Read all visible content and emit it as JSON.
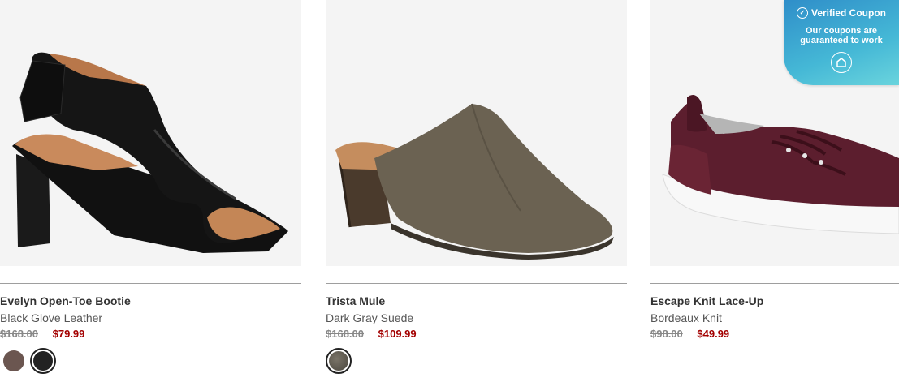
{
  "products": [
    {
      "name": "Evelyn Open-Toe Bootie",
      "color": "Black Glove Leather",
      "old_price": "$168.00",
      "sale_price": "$79.99",
      "swatches": [
        {
          "color": "#6b5650",
          "selected": false
        },
        {
          "color": "#222222",
          "selected": true
        }
      ]
    },
    {
      "name": "Trista Mule",
      "color": "Dark Gray Suede",
      "old_price": "$168.00",
      "sale_price": "$109.99",
      "swatches": [
        {
          "color": "#5e5a52",
          "selected": true
        }
      ]
    },
    {
      "name": "Escape Knit Lace-Up",
      "color": "Bordeaux Knit",
      "old_price": "$98.00",
      "sale_price": "$49.99",
      "swatches": []
    }
  ],
  "coupon": {
    "title": "Verified Coupon",
    "subtitle": "Our coupons are guaranteed to work"
  },
  "colors": {
    "sale_price": "#a30000",
    "coupon_bg": "#3aa7d4",
    "image_bg": "#f4f4f4"
  }
}
